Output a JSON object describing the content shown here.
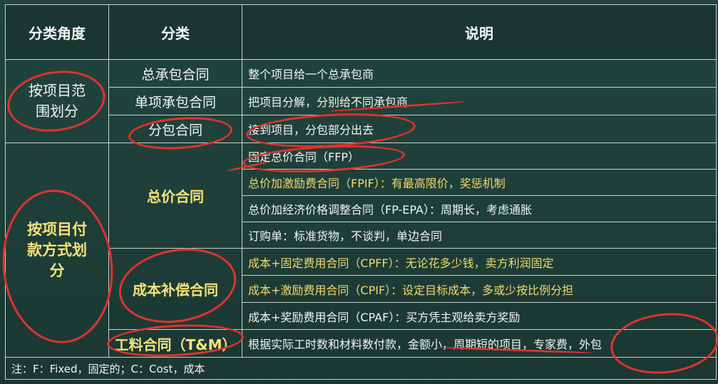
{
  "headers": {
    "angle": "分类角度",
    "category": "分类",
    "description": "说明"
  },
  "groups": {
    "scope": {
      "angle": "按项目范围划分"
    },
    "payment": {
      "angle": "按项目付款方式划分"
    }
  },
  "rows": [
    {
      "category": "总承包合同",
      "description": "整个项目给一个总承包商"
    },
    {
      "category": "单项承包合同",
      "description": "把项目分解，分别给不同承包商"
    },
    {
      "category": "分包合同",
      "description": "接到项目，分包部分出去"
    },
    {
      "category": "总价合同",
      "description": "固定总价合同（FFP）"
    },
    {
      "category": "",
      "description": "总价加激励费合同（FPIF）：有最高限价，奖惩机制"
    },
    {
      "category": "",
      "description": "总价加经济价格调整合同（FP-EPA）：周期长，考虑通胀"
    },
    {
      "category": "",
      "description": "订购单：标准货物，不谈判，单边合同"
    },
    {
      "category": "成本补偿合同",
      "description": "成本+固定费用合同（CPFF）：无论花多少钱，卖方利润固定"
    },
    {
      "category": "",
      "description": "成本+激励费用合同（CPIF）：设定目标成本，多或少按比例分担"
    },
    {
      "category": "",
      "description": "成本+奖励费用合同（CPAF）：买方凭主观给卖方奖励"
    },
    {
      "category": "工料合同（T&M）",
      "description": "根据实际工时数和材料数付款，金额小，周期短的项目，专家费，外包"
    }
  ],
  "note": "注：F：Fixed，固定的；C：Cost，成本",
  "colors": {
    "background": "#1f403a",
    "border": "#c9d3d0",
    "highlight_text": "#f6e27a",
    "annotation_ink": "#e0322e"
  }
}
